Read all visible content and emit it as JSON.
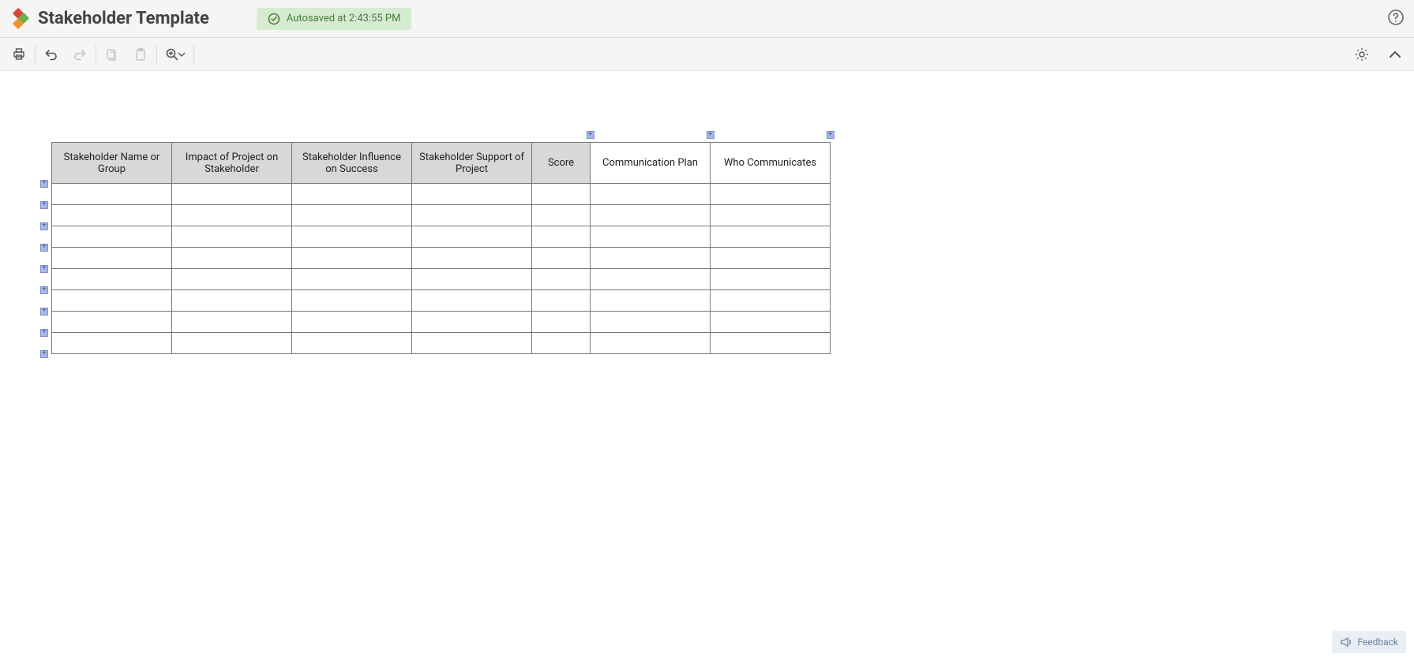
{
  "header": {
    "title": "Stakeholder Template",
    "autosave_text": "Autosaved at 2:43:55 PM"
  },
  "toolbar": {
    "print": "Print",
    "undo": "Undo",
    "redo": "Redo",
    "copy": "Copy",
    "paste": "Paste",
    "zoom": "Zoom",
    "settings": "Settings",
    "collapse": "Collapse"
  },
  "table": {
    "headers": [
      "Stakeholder Name or Group",
      "Impact of Project on Stakeholder",
      "Stakeholder Influence on Success",
      "Stakeholder Support of Project",
      "Score",
      "Communication Plan",
      "Who Communicates"
    ],
    "header_light_from_index": 5,
    "num_data_rows": 8,
    "row_markers_count": 9,
    "col_markers_indices": [
      4,
      5,
      6
    ]
  },
  "feedback": {
    "label": "Feedback"
  }
}
